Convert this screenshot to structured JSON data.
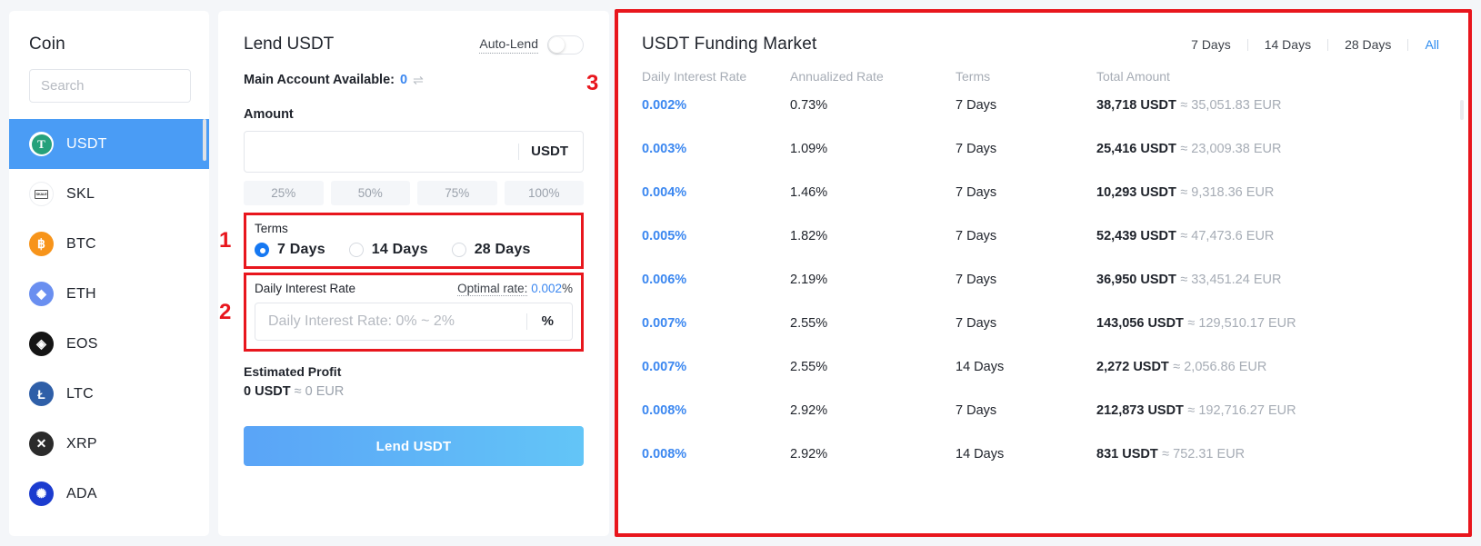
{
  "sidebar": {
    "title": "Coin",
    "search": {
      "placeholder": "Search"
    },
    "items": [
      {
        "symbol": "USDT",
        "icon": "usdt-icon",
        "active": true
      },
      {
        "symbol": "SKL",
        "icon": "skl-icon",
        "active": false
      },
      {
        "symbol": "BTC",
        "icon": "btc-icon",
        "active": false
      },
      {
        "symbol": "ETH",
        "icon": "eth-icon",
        "active": false
      },
      {
        "symbol": "EOS",
        "icon": "eos-icon",
        "active": false
      },
      {
        "symbol": "LTC",
        "icon": "ltc-icon",
        "active": false
      },
      {
        "symbol": "XRP",
        "icon": "xrp-icon",
        "active": false
      },
      {
        "symbol": "ADA",
        "icon": "ada-icon",
        "active": false
      }
    ]
  },
  "lend": {
    "title": "Lend USDT",
    "auto_lend_label": "Auto-Lend",
    "auto_lend_on": false,
    "available_label": "Main Account Available:",
    "available_value": "0",
    "transfer_icon": "⇌",
    "amount_label": "Amount",
    "amount_value": "",
    "amount_placeholder": "",
    "amount_suffix": "USDT",
    "percent_buttons": [
      "25%",
      "50%",
      "75%",
      "100%"
    ],
    "terms": {
      "label": "Terms",
      "options": [
        "7 Days",
        "14 Days",
        "28 Days"
      ],
      "selected": "7 Days"
    },
    "daily_rate": {
      "label": "Daily Interest Rate",
      "optimal_label": "Optimal rate:",
      "optimal_value": "0.002",
      "optimal_unit": "%",
      "placeholder": "Daily Interest Rate: 0% ~ 2%",
      "value": "",
      "suffix": "%"
    },
    "estimated_profit": {
      "label": "Estimated Profit",
      "primary": "0 USDT",
      "approx": "≈ 0 EUR"
    },
    "submit_label": "Lend USDT"
  },
  "market": {
    "title": "USDT Funding Market",
    "tabs": [
      {
        "label": "7 Days",
        "active": false
      },
      {
        "label": "14 Days",
        "active": false
      },
      {
        "label": "28 Days",
        "active": false
      },
      {
        "label": "All",
        "active": true
      }
    ],
    "columns": [
      "Daily Interest Rate",
      "Annualized Rate",
      "Terms",
      "Total Amount"
    ],
    "rows": [
      {
        "daily_rate": "0.002%",
        "annualized": "0.73%",
        "terms": "7 Days",
        "amount": "38,718 USDT",
        "approx": "≈ 35,051.83 EUR"
      },
      {
        "daily_rate": "0.003%",
        "annualized": "1.09%",
        "terms": "7 Days",
        "amount": "25,416 USDT",
        "approx": "≈ 23,009.38 EUR"
      },
      {
        "daily_rate": "0.004%",
        "annualized": "1.46%",
        "terms": "7 Days",
        "amount": "10,293 USDT",
        "approx": "≈ 9,318.36 EUR"
      },
      {
        "daily_rate": "0.005%",
        "annualized": "1.82%",
        "terms": "7 Days",
        "amount": "52,439 USDT",
        "approx": "≈ 47,473.6 EUR"
      },
      {
        "daily_rate": "0.006%",
        "annualized": "2.19%",
        "terms": "7 Days",
        "amount": "36,950 USDT",
        "approx": "≈ 33,451.24 EUR"
      },
      {
        "daily_rate": "0.007%",
        "annualized": "2.55%",
        "terms": "7 Days",
        "amount": "143,056 USDT",
        "approx": "≈ 129,510.17 EUR"
      },
      {
        "daily_rate": "0.007%",
        "annualized": "2.55%",
        "terms": "14 Days",
        "amount": "2,272 USDT",
        "approx": "≈ 2,056.86 EUR"
      },
      {
        "daily_rate": "0.008%",
        "annualized": "2.92%",
        "terms": "7 Days",
        "amount": "212,873 USDT",
        "approx": "≈ 192,716.27 EUR"
      },
      {
        "daily_rate": "0.008%",
        "annualized": "2.92%",
        "terms": "14 Days",
        "amount": "831 USDT",
        "approx": "≈ 752.31 EUR"
      }
    ]
  },
  "annotations": {
    "one": "1",
    "two": "2",
    "three": "3",
    "color": "#e8161d"
  }
}
